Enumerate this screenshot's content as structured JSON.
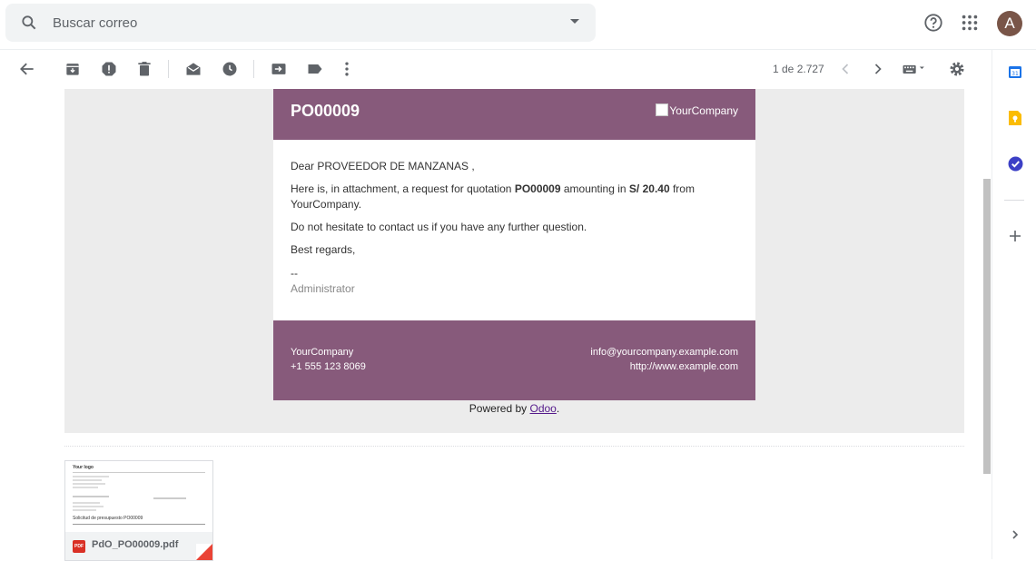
{
  "search": {
    "placeholder": "Buscar correo"
  },
  "header": {
    "avatar_letter": "A"
  },
  "toolbar": {
    "page_count": "1 de 2.727"
  },
  "email": {
    "po_number": "PO00009",
    "logo_alt": "YourCompany",
    "greeting": "Dear PROVEEDOR DE MANZANAS ,",
    "intro_prefix": "Here is, in attachment, a request for quotation ",
    "intro_po": "PO00009",
    "intro_middle": " amounting in ",
    "intro_amount": "S/ 20.40",
    "intro_suffix": " from",
    "intro_line2": "YourCompany.",
    "contact_line": "Do not hesitate to contact us if you have any further question.",
    "closing": "Best regards,",
    "sig_dashes": "--",
    "signature": "Administrator",
    "footer": {
      "company": "YourCompany",
      "phone": "+1 555 123 8069",
      "email": "info@yourcompany.example.com",
      "website": "http://www.example.com"
    },
    "powered_prefix": "Powered by ",
    "powered_link": "Odoo",
    "powered_suffix": "."
  },
  "attachment": {
    "filename": "PdO_PO00009.pdf",
    "file_type": "PDF",
    "preview_logo": "Your logo",
    "preview_title": "Solicitud de presupuesto PO00009"
  },
  "colors": {
    "odoo_purple": "#875a7b",
    "message_bg": "#ececec",
    "avatar": "#795548"
  },
  "icons": [
    "search-icon",
    "chevron-down-icon",
    "help-icon",
    "apps-grid-icon",
    "back-arrow-icon",
    "archive-icon",
    "report-spam-icon",
    "delete-icon",
    "mark-unread-icon",
    "snooze-icon",
    "move-to-icon",
    "label-icon",
    "more-vert-icon",
    "chevron-left-icon",
    "chevron-right-icon",
    "keyboard-icon",
    "settings-icon",
    "calendar-icon",
    "keep-icon",
    "tasks-icon",
    "add-icon"
  ]
}
